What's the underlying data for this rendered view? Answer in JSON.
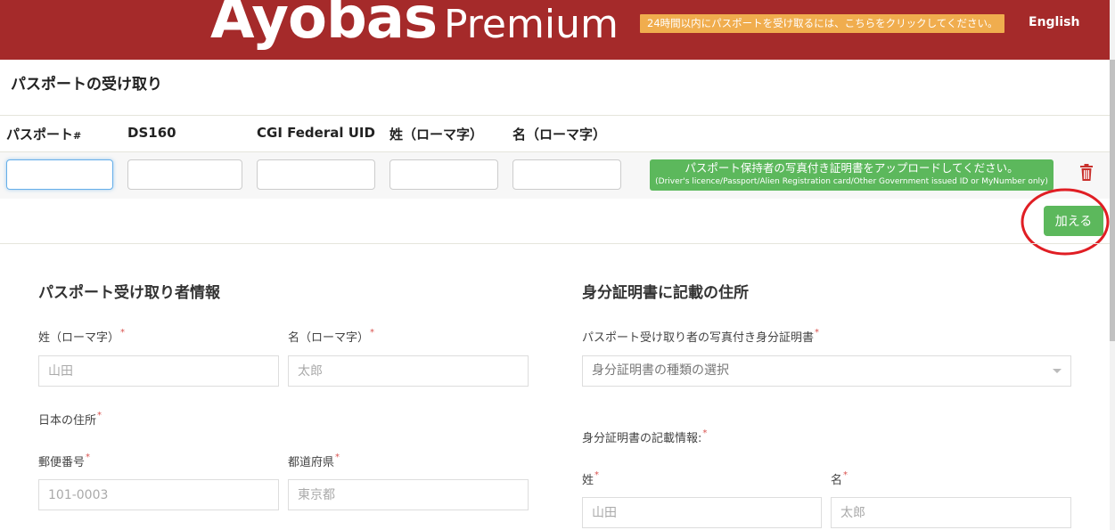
{
  "header": {
    "logo_main": "Ayobas",
    "logo_sub": "Premium",
    "notice": "24時間以内にパスポートを受け取るには、こちらをクリックしてください。",
    "language": "English"
  },
  "page": {
    "title": "パスポートの受け取り"
  },
  "passport_table": {
    "columns": {
      "passport": "パスポート",
      "passport_suffix": "#",
      "ds160": "DS160",
      "cgi": "CGI Federal UID",
      "last_name": "姓（ローマ字）",
      "first_name": "名（ローマ字）"
    },
    "row": {
      "passport_value": "",
      "ds160_value": "",
      "cgi_value": "",
      "last_name_value": "",
      "first_name_value": ""
    },
    "upload_line1": "パスポート保持者の写真付き証明書をアップロードしてください。",
    "upload_line2": "(Driver's licence/Passport/Alien Registration card/Other Government issued ID or MyNumber only)",
    "delete_icon": "trash-icon",
    "add_label": "加える"
  },
  "recipient": {
    "title": "パスポート受け取り者情報",
    "last_name_label": "姓（ローマ字）",
    "last_name_placeholder": "山田",
    "first_name_label": "名（ローマ字）",
    "first_name_placeholder": "太郎",
    "address_label": "日本の住所",
    "postal_label": "郵便番号",
    "postal_placeholder": "101-0003",
    "prefecture_label": "都道府県",
    "prefecture_placeholder": "東京都",
    "required_mark": "*"
  },
  "id_address": {
    "title": "身分証明書に記載の住所",
    "photo_id_label": "パスポート受け取り者の写真付き身分証明書",
    "id_type_selected": "身分証明書の種類の選択",
    "id_info_label": "身分証明書の記載情報:",
    "last_name_label": "姓",
    "last_name_placeholder": "山田",
    "first_name_label": "名",
    "first_name_placeholder": "太郎"
  },
  "colors": {
    "header_bg": "#a52a2a",
    "notice_bg": "#f0ad4e",
    "success": "#5cb85c",
    "annotation": "#e01e24",
    "required": "#d9534f"
  }
}
